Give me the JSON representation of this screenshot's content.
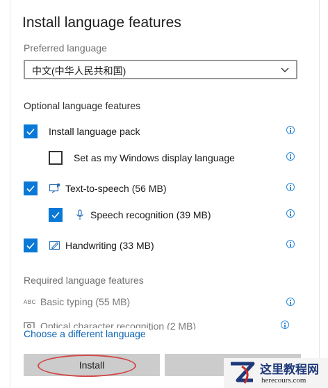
{
  "dialog": {
    "title": "Install language features"
  },
  "preferred": {
    "label": "Preferred language",
    "selected": "中文(中华人民共和国)"
  },
  "optional": {
    "heading": "Optional language features",
    "items": [
      {
        "label": "Install language pack",
        "checked": true
      },
      {
        "label": "Set as my Windows display language",
        "checked": false
      },
      {
        "label": "Text-to-speech (56 MB)",
        "checked": true,
        "icon": "text-to-speech-icon"
      },
      {
        "label": "Speech recognition (39 MB)",
        "checked": true,
        "icon": "microphone-icon"
      },
      {
        "label": "Handwriting (33 MB)",
        "checked": true,
        "icon": "handwriting-icon"
      }
    ]
  },
  "required": {
    "heading": "Required language features",
    "items": [
      {
        "label": "Basic typing (55 MB)",
        "icon_text": "ABC"
      },
      {
        "label": "Optical character recognition (2 MB)",
        "icon": "ocr-icon"
      }
    ]
  },
  "link": "Choose a different language",
  "buttons": {
    "install": "Install"
  },
  "watermark": {
    "title": "这里教程网",
    "domain": "herecours.com"
  },
  "colors": {
    "accent": "#0a78d7",
    "link": "#0b63b6",
    "info": "#2b88d8",
    "annotation": "#d24a4a"
  }
}
